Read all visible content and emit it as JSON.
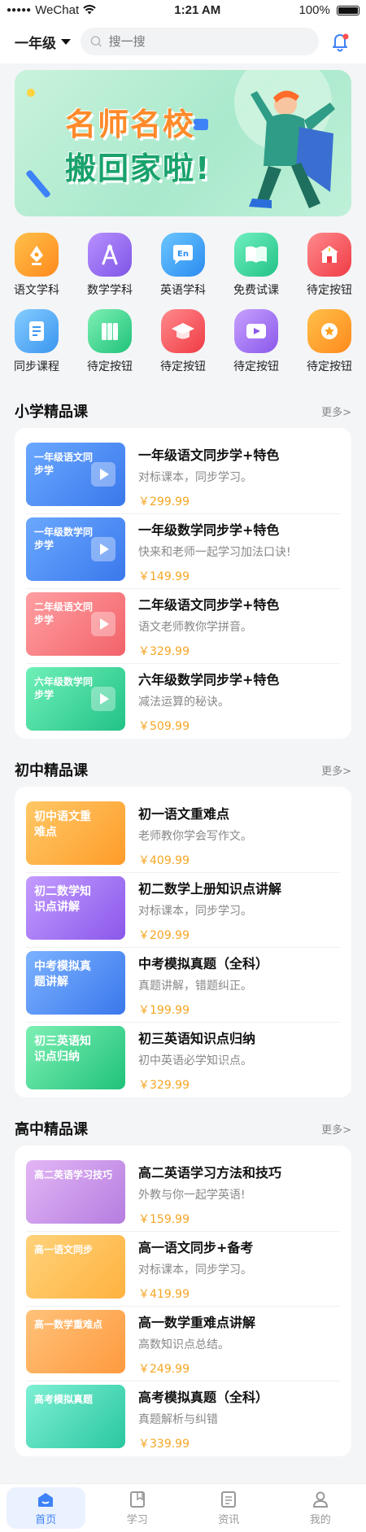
{
  "status_bar": {
    "carrier": "WeChat",
    "time": "1:21 AM",
    "battery": "100%"
  },
  "header": {
    "grade": "一年级",
    "search_placeholder": "搜一搜"
  },
  "banner": {
    "line1": "名师名校",
    "line2": "搬回家啦!"
  },
  "categories": [
    {
      "label": "语文学科",
      "icon": "pen-nib-icon",
      "color": "#ff9f1c"
    },
    {
      "label": "数学学科",
      "icon": "compass-icon",
      "color": "#9b6cf0"
    },
    {
      "label": "英语学科",
      "icon": "english-bubble-icon",
      "color": "#3aa7f5"
    },
    {
      "label": "免费试课",
      "icon": "open-book-icon",
      "color": "#37d39a"
    },
    {
      "label": "待定按钮",
      "icon": "school-icon",
      "color": "#f5545a"
    },
    {
      "label": "同步课程",
      "icon": "document-icon",
      "color": "#4aa7f5"
    },
    {
      "label": "待定按钮",
      "icon": "books-icon",
      "color": "#3fd48f"
    },
    {
      "label": "待定按钮",
      "icon": "graduation-cap-icon",
      "color": "#f5545a"
    },
    {
      "label": "待定按钮",
      "icon": "video-icon",
      "color": "#a36cf0"
    },
    {
      "label": "待定按钮",
      "icon": "medal-icon",
      "color": "#ff9f1c"
    }
  ],
  "primary": {
    "title": "小学精品课",
    "more": "更多>",
    "courses": [
      {
        "thumb_text": "一年级语文同步学",
        "title": "一年级语文同步学+特色",
        "desc": "对标课本，同步学习。",
        "price": "￥299.99",
        "color": "#4c8ff5"
      },
      {
        "thumb_text": "一年级数学同步学",
        "title": "一年级数学同步学+特色",
        "desc": "快来和老师一起学习加法口诀!",
        "price": "￥149.99",
        "color": "#4c8ff5"
      },
      {
        "thumb_text": "二年级语文同步学",
        "title": "二年级语文同步学+特色",
        "desc": "语文老师教你学拼音。",
        "price": "￥329.99",
        "color": "#f77b80"
      },
      {
        "thumb_text": "六年级数学同步学",
        "title": "六年级数学同步学+特色",
        "desc": "减法运算的秘诀。",
        "price": "￥509.99",
        "color": "#35d39a"
      }
    ]
  },
  "junior": {
    "title": "初中精品课",
    "more": "更多>",
    "courses": [
      {
        "thumb_text": "初中语文重难点",
        "title": "初一语文重难点",
        "desc": "老师教你学会写作文。",
        "price": "￥409.99",
        "color": "#ffb23f"
      },
      {
        "thumb_text": "初二数学知识点讲解",
        "title": "初二数学上册知识点讲解",
        "desc": "对标课本，同步学习。",
        "price": "￥209.99",
        "color": "#9b6cf0"
      },
      {
        "thumb_text": "中考模拟真题讲解",
        "title": "中考模拟真题（全科）",
        "desc": "真题讲解，错题纠正。",
        "price": "￥199.99",
        "color": "#4c8ff5"
      },
      {
        "thumb_text": "初三英语知识点归纳",
        "title": "初三英语知识点归纳",
        "desc": "初中英语必学知识点。",
        "price": "￥329.99",
        "color": "#35d39a"
      }
    ]
  },
  "senior": {
    "title": "高中精品课",
    "more": "更多>",
    "courses": [
      {
        "thumb_text": "高二英语学习技巧",
        "title": "高二英语学习方法和技巧",
        "desc": "外教与你一起学英语!",
        "price": "￥159.99",
        "color": "#c98ee6"
      },
      {
        "thumb_text": "高一语文同步",
        "title": "高一语文同步+备考",
        "desc": "对标课本，同步学习。",
        "price": "￥419.99",
        "color": "#ffb23f"
      },
      {
        "thumb_text": "高一数学重难点",
        "title": "高一数学重难点讲解",
        "desc": "高数知识点总结。",
        "price": "￥249.99",
        "color": "#ffa23f"
      },
      {
        "thumb_text": "高考模拟真题",
        "title": "高考模拟真题（全科）",
        "desc": "真题解析与纠错",
        "price": "￥339.99",
        "color": "#35d3b0"
      }
    ]
  },
  "tabbar": [
    {
      "label": "首页",
      "icon": "home-icon",
      "active": true
    },
    {
      "label": "学习",
      "icon": "book-icon",
      "active": false
    },
    {
      "label": "资讯",
      "icon": "news-icon",
      "active": false
    },
    {
      "label": "我的",
      "icon": "user-icon",
      "active": false
    }
  ],
  "colors": {
    "accent": "#3e82f7",
    "price": "#f5a623"
  }
}
